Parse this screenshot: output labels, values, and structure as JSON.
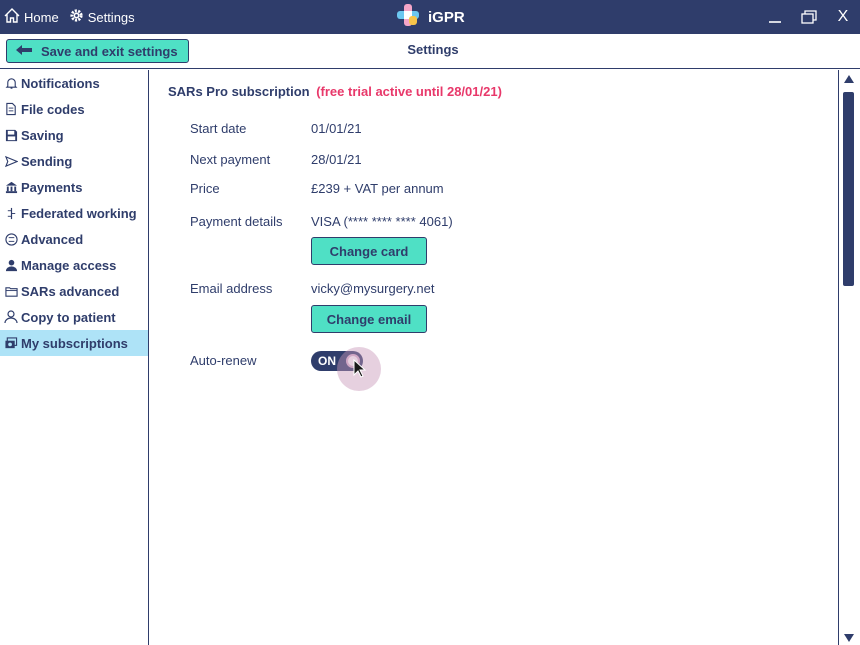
{
  "titlebar": {
    "home_label": "Home",
    "settings_label": "Settings",
    "app_name": "iGPR",
    "minimize": "—",
    "close": "X"
  },
  "header": {
    "save_label": "Save and exit settings",
    "page_title": "Settings"
  },
  "sidebar": {
    "items": [
      {
        "label": "Notifications",
        "icon": "bell-icon"
      },
      {
        "label": "File codes",
        "icon": "file-code-icon"
      },
      {
        "label": "Saving",
        "icon": "floppy-disk-icon"
      },
      {
        "label": "Sending",
        "icon": "send-icon"
      },
      {
        "label": "Payments",
        "icon": "bank-icon"
      },
      {
        "label": "Federated working",
        "icon": "federated-icon"
      },
      {
        "label": "Advanced",
        "icon": "advanced-icon"
      },
      {
        "label": "Manage access",
        "icon": "user-icon"
      },
      {
        "label": "SARs advanced",
        "icon": "folder-icon"
      },
      {
        "label": "Copy to patient",
        "icon": "person-outline-icon"
      },
      {
        "label": "My subscriptions",
        "icon": "subscriptions-icon"
      }
    ],
    "active_index": 10
  },
  "subscription": {
    "title": "SARs Pro subscription",
    "trial_note": "(free trial active until 28/01/21)",
    "start_date_label": "Start date",
    "start_date": "01/01/21",
    "next_payment_label": "Next payment",
    "next_payment": "28/01/21",
    "price_label": "Price",
    "price": "£239 + VAT per annum",
    "payment_details_label": "Payment details",
    "payment_details": "VISA (**** **** **** 4061)",
    "change_card_label": "Change card",
    "email_label": "Email address",
    "email": "vicky@mysurgery.net",
    "change_email_label": "Change email",
    "auto_renew_label": "Auto-renew",
    "auto_renew_state": "ON"
  },
  "colors": {
    "navy": "#2f3d6b",
    "accent": "#4fe0c5",
    "trial": "#e8386a",
    "active_bg": "#aee3f7"
  }
}
